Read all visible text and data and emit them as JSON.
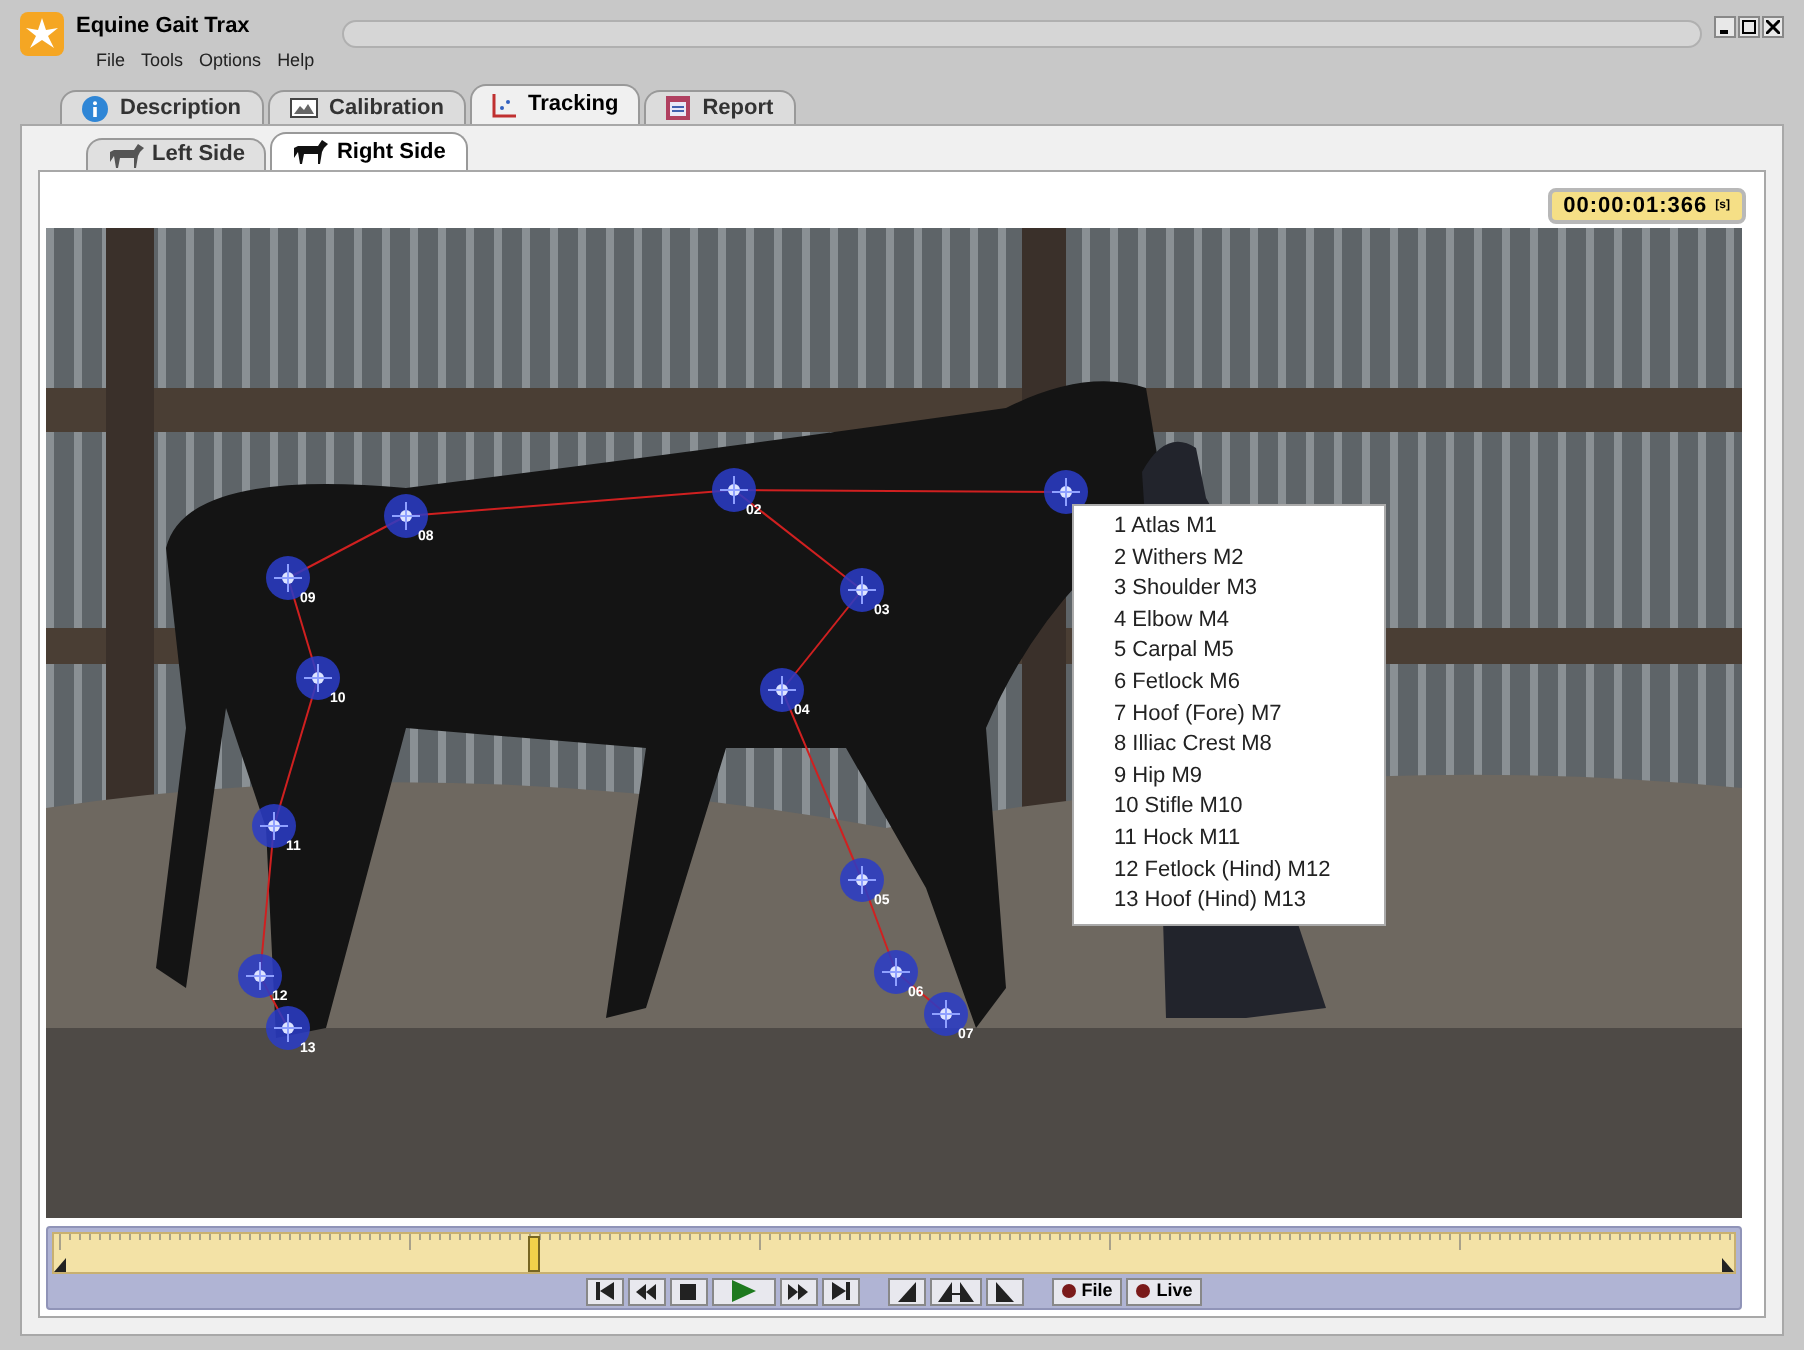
{
  "window": {
    "title": "Equine Gait Trax"
  },
  "menu": [
    "File",
    "Tools",
    "Options",
    "Help"
  ],
  "tabs": [
    {
      "label": "Description",
      "kind": "info",
      "selected": false
    },
    {
      "label": "Calibration",
      "kind": "calibration",
      "selected": false
    },
    {
      "label": "Tracking",
      "kind": "axes",
      "selected": true
    },
    {
      "label": "Report",
      "kind": "report",
      "selected": false
    }
  ],
  "side_tabs": [
    {
      "label": "Left Side",
      "selected": false
    },
    {
      "label": "Right Side",
      "selected": true
    }
  ],
  "timer": {
    "value": "00:00:01:366",
    "unit": "[s]"
  },
  "video": {
    "kind": "picture",
    "markers": [
      {
        "kind": "marker"
      },
      {
        "kind": "marker",
        "label": "02"
      },
      {
        "kind": "marker",
        "label": "03"
      },
      {
        "kind": "marker",
        "label": "04"
      },
      {
        "kind": "marker",
        "label": "05"
      },
      {
        "kind": "marker",
        "label": "06"
      },
      {
        "kind": "marker",
        "label": "07"
      },
      {
        "kind": "marker",
        "label": "08"
      },
      {
        "kind": "marker",
        "label": "09"
      },
      {
        "kind": "marker",
        "label": "10"
      },
      {
        "kind": "marker",
        "label": "11"
      },
      {
        "kind": "marker",
        "label": "12"
      },
      {
        "kind": "marker",
        "label": "13"
      }
    ]
  },
  "marker_menu": {
    "items": [
      "1 Atlas M1",
      "2 Withers M2",
      "3 Shoulder M3",
      "4 Elbow M4",
      "5 Carpal M5",
      "6 Fetlock M6",
      "7 Hoof (Fore) M7",
      "8 Illiac Crest M8",
      "9 Hip M9",
      "10 Stifle M10",
      "11 Hock M11",
      "12 Fetlock (Hind) M12",
      "13 Hoof (Hind) M13"
    ]
  },
  "timeline": {
    "level": 0.286
  },
  "playback_buttons": [
    {
      "kind": "first"
    },
    {
      "kind": "rewind"
    },
    {
      "kind": "stop"
    },
    {
      "kind": "play"
    },
    {
      "kind": "forward"
    },
    {
      "kind": "last"
    }
  ],
  "mark_buttons": [
    {
      "kind": "mark-in"
    },
    {
      "kind": "mark-range"
    },
    {
      "kind": "mark-out"
    }
  ],
  "record_buttons": [
    {
      "label": "File"
    },
    {
      "label": "Live"
    }
  ]
}
